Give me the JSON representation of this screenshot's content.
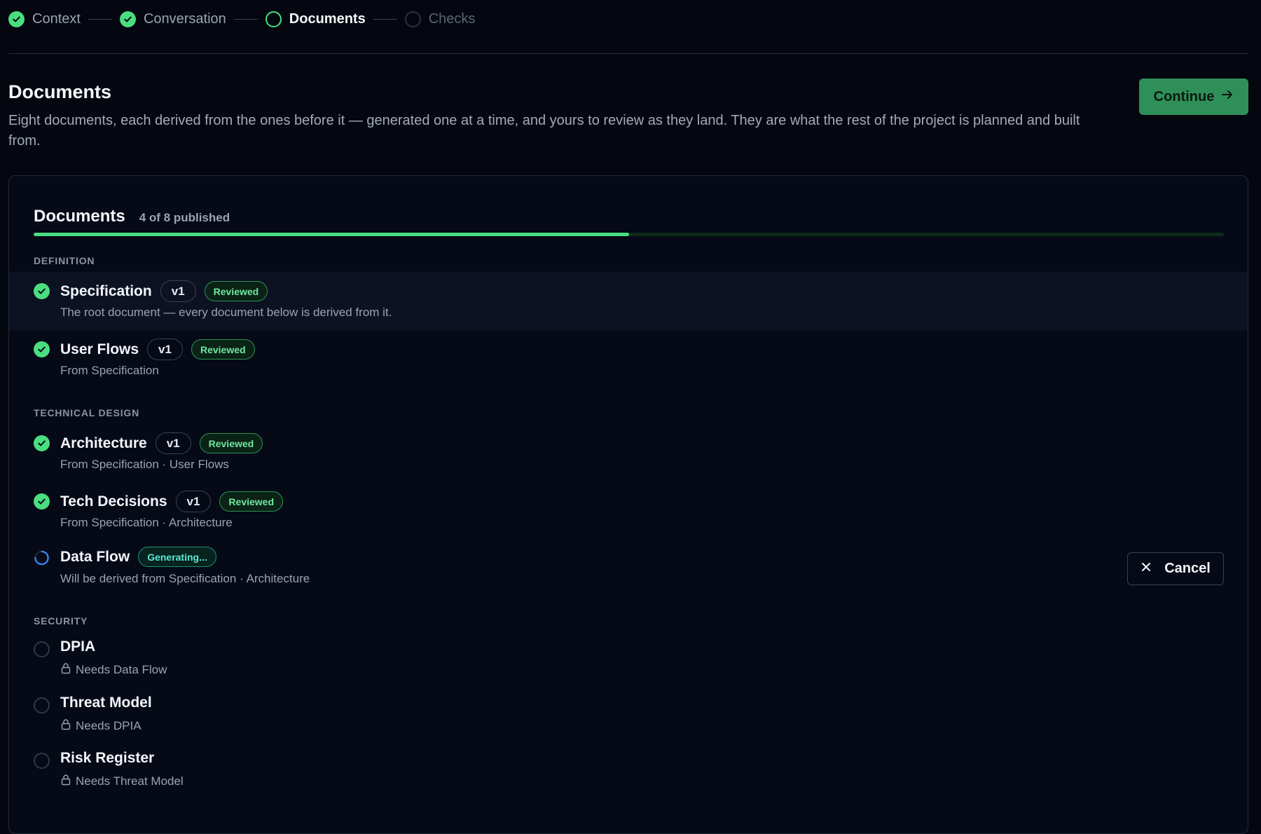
{
  "stepper": [
    {
      "label": "Context",
      "state": "done"
    },
    {
      "label": "Conversation",
      "state": "done"
    },
    {
      "label": "Documents",
      "state": "active"
    },
    {
      "label": "Checks",
      "state": "pending"
    }
  ],
  "header": {
    "title": "Documents",
    "description": "Eight documents, each derived from the ones before it — generated one at a time, and yours to review as they land. They are what the rest of the project is planned and built from.",
    "continue_label": "Continue"
  },
  "card": {
    "title": "Documents",
    "count_text": "4 of 8 published",
    "progress_fraction": 0.5
  },
  "sections": {
    "definition": "DEFINITION",
    "technical": "TECHNICAL DESIGN",
    "security": "SECURITY"
  },
  "docs": {
    "specification": {
      "title": "Specification",
      "version": "v1",
      "badge": "Reviewed",
      "sub": "The root document — every document below is derived from it."
    },
    "user_flows": {
      "title": "User Flows",
      "version": "v1",
      "badge": "Reviewed",
      "sub": "From Specification"
    },
    "architecture": {
      "title": "Architecture",
      "version": "v1",
      "badge": "Reviewed",
      "sub": "From Specification · User Flows"
    },
    "tech_decisions": {
      "title": "Tech Decisions",
      "version": "v1",
      "badge": "Reviewed",
      "sub": "From Specification · Architecture"
    },
    "data_flow": {
      "title": "Data Flow",
      "badge": "Generating...",
      "sub": "Will be derived from Specification · Architecture",
      "cancel_label": "Cancel"
    },
    "dpia": {
      "title": "DPIA",
      "sub": "Needs Data Flow"
    },
    "threat_model": {
      "title": "Threat Model",
      "sub": "Needs DPIA"
    },
    "risk_register": {
      "title": "Risk Register",
      "sub": "Needs Threat Model"
    }
  },
  "colors": {
    "accent": "#4ade80",
    "button": "#2f8f58",
    "background": "#04070f",
    "generating": "#3b82f6"
  }
}
